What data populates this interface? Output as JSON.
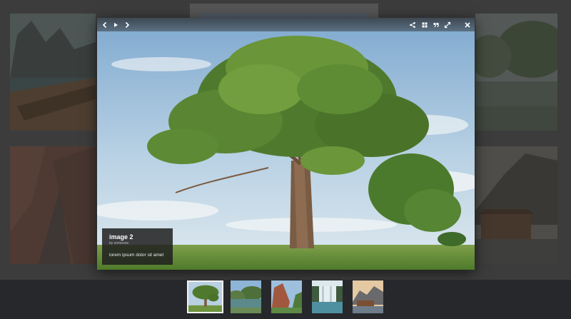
{
  "toolbar": {
    "prev_icon": "chevron-left-icon",
    "play_icon": "play-icon",
    "next_icon": "chevron-right-icon",
    "share_icon": "share-icon",
    "grid_icon": "grid-icon",
    "caption_icon": "quote-icon",
    "fullscreen_icon": "fullscreen-icon",
    "close_icon": "close-icon"
  },
  "caption": {
    "title": "image 2",
    "author": "by someone",
    "description": "lorem ipsum dolor sit amet"
  },
  "thumbnails": [
    {
      "name": "thumbnail-tree",
      "active": true
    },
    {
      "name": "thumbnail-lake"
    },
    {
      "name": "thumbnail-cliff"
    },
    {
      "name": "thumbnail-waterfall"
    },
    {
      "name": "thumbnail-house-mountain"
    }
  ],
  "colors": {
    "overlay": "#545454",
    "strip": "#26282c",
    "caption_bg": "#1e1e1e",
    "active_border": "#f2f2f2"
  }
}
